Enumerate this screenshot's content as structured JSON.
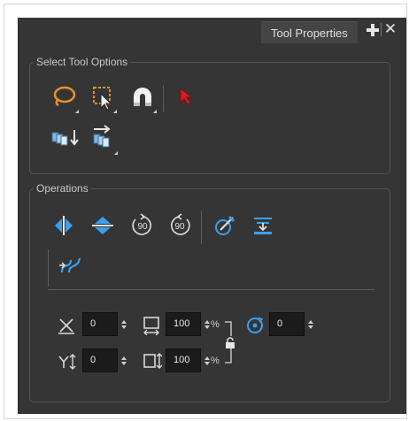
{
  "panel": {
    "tab_title": "Tool Properties"
  },
  "select_tool_options": {
    "title": "Select Tool Options",
    "row1": [
      "lasso-icon",
      "marquee-icon",
      "snap-magnet-icon",
      "select-arrow-icon"
    ],
    "row2": [
      "apply-to-elements-icon",
      "apply-to-drawing-icon"
    ]
  },
  "operations": {
    "title": "Operations",
    "row1": [
      "flip-horizontal-icon",
      "flip-vertical-icon",
      "rotate-90-cw-icon",
      "rotate-90-ccw-icon",
      "create-colour-art-icon",
      "flatten-icon"
    ],
    "row2": [
      "smooth-icon"
    ],
    "transform": {
      "width_offset": "0",
      "width_percent": "100",
      "percent_sign": "%",
      "angle": "0",
      "height_offset": "0",
      "height_percent": "100",
      "percent_sign_2": "%"
    },
    "rotate_90_label": "90",
    "rotate_90_ccw_label": "90"
  },
  "colors": {
    "panel_bg": "#353535",
    "accent_blue": "#3aa0f0",
    "lasso_orange": "#e8912b",
    "arrow_red": "#d11f1f"
  }
}
